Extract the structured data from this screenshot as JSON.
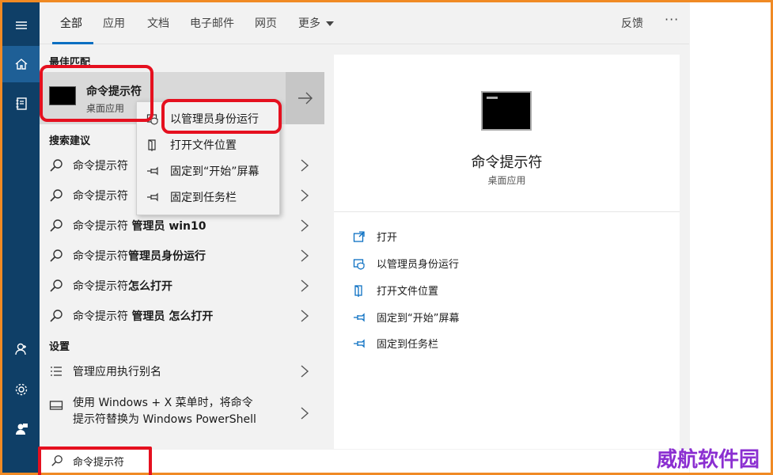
{
  "tabs": [
    {
      "label": "全部",
      "active": true
    },
    {
      "label": "应用"
    },
    {
      "label": "文档"
    },
    {
      "label": "电子邮件"
    },
    {
      "label": "网页"
    },
    {
      "label": "更多"
    }
  ],
  "header": {
    "feedback": "反馈",
    "more": "···"
  },
  "best_match": {
    "section": "最佳匹配",
    "name": "命令提示符",
    "subtitle": "桌面应用"
  },
  "context_menu": [
    {
      "label": "以管理员身份运行",
      "icon": "shield-icon"
    },
    {
      "label": "打开文件位置",
      "icon": "folder-icon"
    },
    {
      "label": "固定到“开始”屏幕",
      "icon": "pin-icon"
    },
    {
      "label": "固定到任务栏",
      "icon": "pin-icon"
    }
  ],
  "suggestions": {
    "section": "搜索建议",
    "items": [
      {
        "prefix": "命令提示符",
        "bold": ""
      },
      {
        "prefix": "命令提示符",
        "bold": ""
      },
      {
        "prefix": "命令提示符 ",
        "bold": "管理员 win10"
      },
      {
        "prefix": "命令提示符",
        "bold": "管理员身份运行"
      },
      {
        "prefix": "命令提示符",
        "bold": "怎么打开"
      },
      {
        "prefix": "命令提示符 ",
        "bold": "管理员 怎么打开"
      }
    ]
  },
  "settings": {
    "section": "设置",
    "items": [
      {
        "label": "管理应用执行别名"
      },
      {
        "line1": "使用 Windows + X 菜单时，将命令",
        "line2": "提示符替换为 Windows PowerShell"
      }
    ]
  },
  "preview": {
    "name": "命令提示符",
    "subtitle": "桌面应用",
    "actions": [
      {
        "label": "打开",
        "icon": "open-icon"
      },
      {
        "label": "以管理员身份运行",
        "icon": "shield-icon"
      },
      {
        "label": "打开文件位置",
        "icon": "folder-icon"
      },
      {
        "label": "固定到“开始”屏幕",
        "icon": "pin-icon"
      },
      {
        "label": "固定到任务栏",
        "icon": "pin-icon"
      }
    ]
  },
  "search": {
    "value": "命令提示符"
  },
  "watermark": "威航软件园",
  "colors": {
    "rail": "#0f3f67",
    "accent": "#0a6fc2",
    "highlight": "#e5101f"
  }
}
